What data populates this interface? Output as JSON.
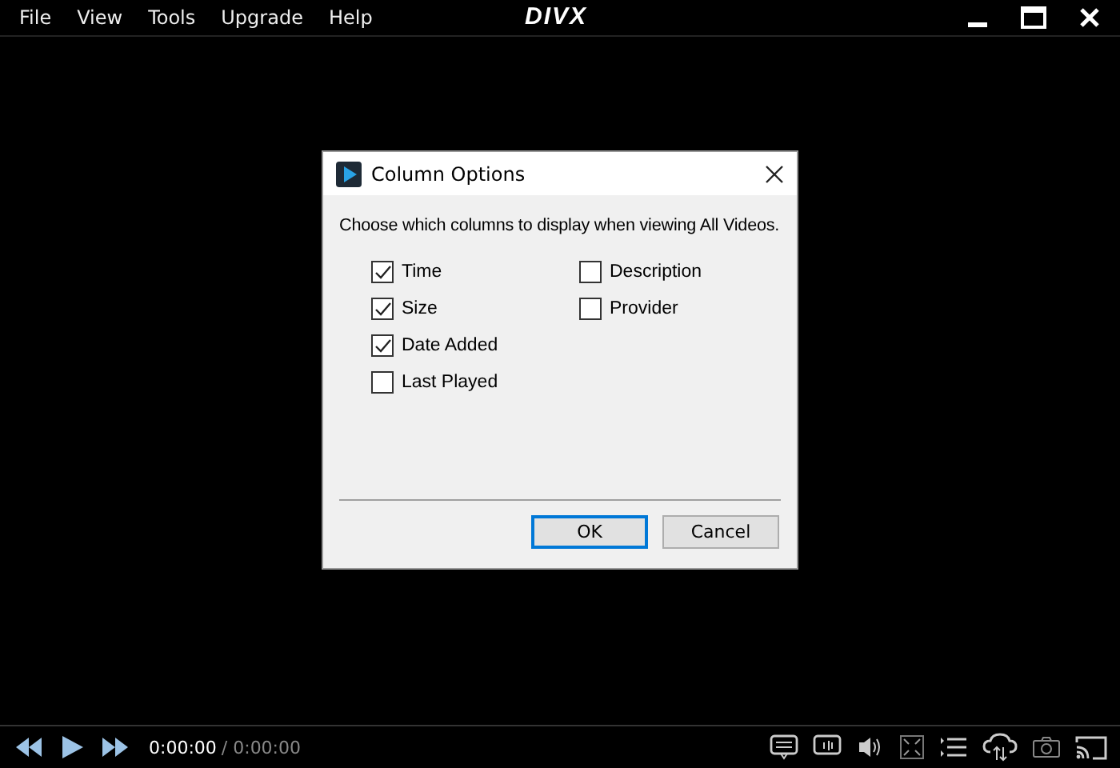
{
  "menu": [
    "File",
    "View",
    "Tools",
    "Upgrade",
    "Help"
  ],
  "logo": "DIVX",
  "dialog": {
    "title": "Column Options",
    "prompt": "Choose which columns to display when viewing All Videos.",
    "columns_left": [
      {
        "label": "Time",
        "checked": true
      },
      {
        "label": "Size",
        "checked": true
      },
      {
        "label": "Date Added",
        "checked": true
      },
      {
        "label": "Last Played",
        "checked": false
      }
    ],
    "columns_right": [
      {
        "label": "Description",
        "checked": false
      },
      {
        "label": "Provider",
        "checked": false
      }
    ],
    "buttons": [
      {
        "label": "OK",
        "default": true
      },
      {
        "label": "Cancel",
        "default": false
      }
    ]
  },
  "player": {
    "elapsed": "0:00:00",
    "duration": "/ 0:00:00"
  }
}
